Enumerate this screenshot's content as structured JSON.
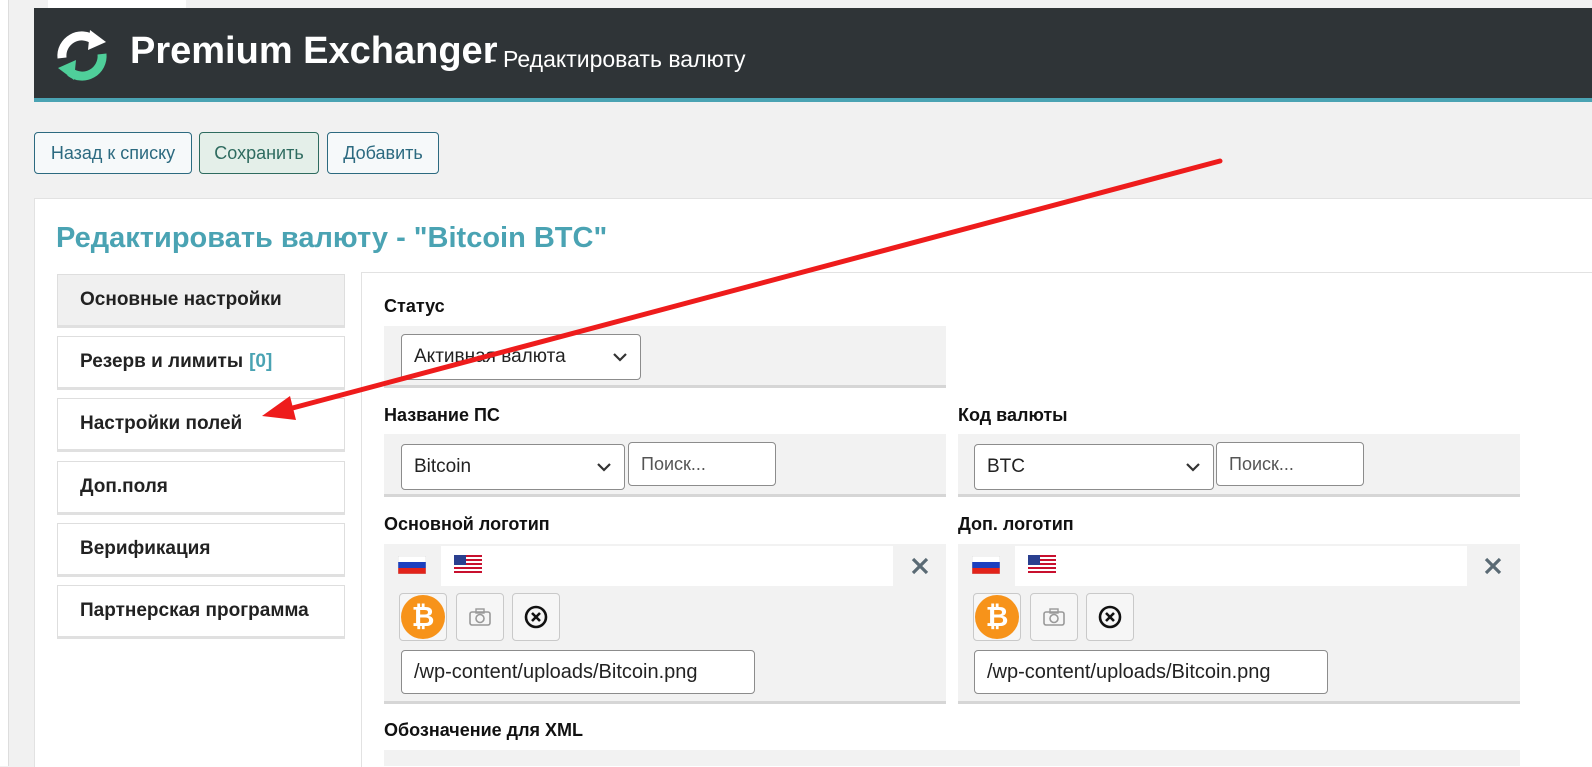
{
  "header": {
    "brand": "Premium Exchanger",
    "subtitle": "- Редактировать валюту"
  },
  "toolbar": {
    "back_label": "Назад к списку",
    "save_label": "Сохранить",
    "add_label": "Добавить"
  },
  "page_title": "Редактировать валюту - \"Bitcoin BTC\"",
  "tabs": [
    {
      "label": "Основные настройки",
      "active": true
    },
    {
      "label": "Резерв и лимиты",
      "count": "[0]"
    },
    {
      "label": "Настройки полей"
    },
    {
      "label": "Доп.поля"
    },
    {
      "label": "Верификация"
    },
    {
      "label": "Партнерская программа"
    }
  ],
  "form": {
    "status": {
      "label": "Статус",
      "value": "Активная валюта"
    },
    "ps_name": {
      "label": "Название ПС",
      "value": "Bitcoin",
      "search_placeholder": "Поиск..."
    },
    "currency_code": {
      "label": "Код валюты",
      "value": "BTC",
      "search_placeholder": "Поиск..."
    },
    "main_logo": {
      "label": "Основной логотип",
      "path": "/wp-content/uploads/Bitcoin.png",
      "glyph": "₿"
    },
    "extra_logo": {
      "label": "Доп. логотип",
      "path": "/wp-content/uploads/Bitcoin.png",
      "glyph": "₿"
    },
    "xml_label": "Обозначение для XML"
  },
  "icons": {
    "logo": "refresh-cycle-icon",
    "chevron": "chevron-down-icon",
    "flag_ru": "russia-flag-icon",
    "flag_us": "usa-flag-icon",
    "close": "close-icon",
    "camera": "camera-icon",
    "remove": "remove-circle-icon",
    "annotation": "red-arrow-icon"
  },
  "colors": {
    "header_bg": "#2f3437",
    "accent": "#4aa3b3",
    "bitcoin": "#f7931a",
    "arrow": "#ee1c1c"
  }
}
